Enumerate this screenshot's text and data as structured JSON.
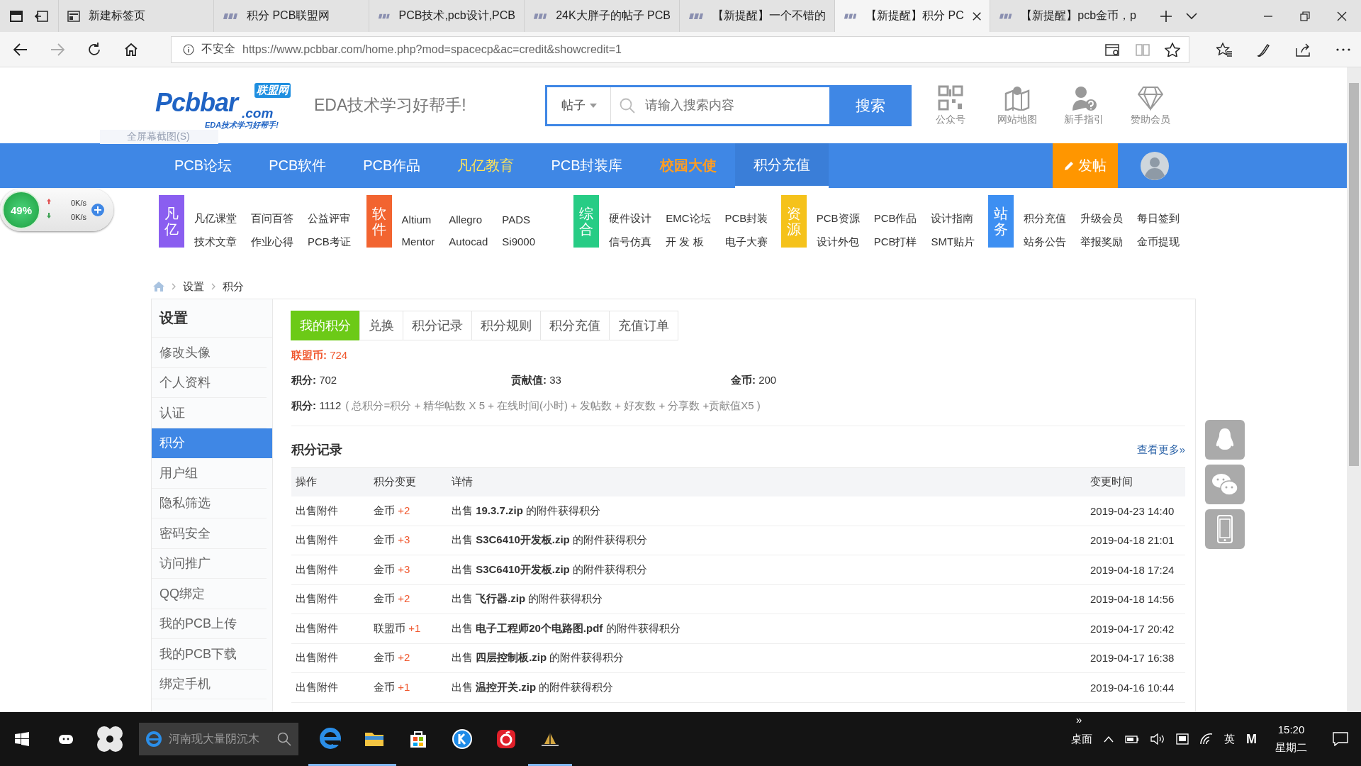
{
  "browser": {
    "tabs": [
      {
        "title": "新建标签页",
        "kind": "newtab",
        "selected": false
      },
      {
        "title": "积分 PCB联盟网",
        "kind": "site",
        "selected": false
      },
      {
        "title": "PCB技术,pcb设计,PCB",
        "kind": "site",
        "selected": false
      },
      {
        "title": "24K大胖子的帖子 PCB",
        "kind": "site",
        "selected": false
      },
      {
        "title": "【新提醒】一个不错的",
        "kind": "site",
        "selected": false
      },
      {
        "title": "【新提醒】积分 PC",
        "kind": "site",
        "selected": true
      },
      {
        "title": "【新提醒】pcb金币，p",
        "kind": "site",
        "selected": false
      }
    ],
    "nav_buttons": [
      {
        "kind": "back",
        "disabled": false
      },
      {
        "kind": "forward",
        "disabled": true
      },
      {
        "kind": "refresh",
        "disabled": false
      },
      {
        "kind": "home",
        "disabled": false
      }
    ],
    "security": "不安全",
    "url": "https://www.pcbbar.com/home.php?mod=spacecp&ac=credit&showcredit=1"
  },
  "header": {
    "logo": {
      "name": "Pcbbar",
      "suffix": ".com",
      "badge": "联盟网",
      "slogan": "EDA技术学习好帮手!"
    },
    "ghost_tooltip": "全屏幕截图(S)",
    "tagline": "EDA技术学习好帮手!",
    "search": {
      "scope": "帖子",
      "placeholder": "请输入搜索内容",
      "button": "搜索"
    },
    "links": [
      {
        "kind": "qrcode",
        "label": "公众号"
      },
      {
        "kind": "map",
        "label": "网站地图"
      },
      {
        "kind": "guide",
        "label": "新手指引"
      },
      {
        "kind": "diamond",
        "label": "赞助会员"
      }
    ]
  },
  "nav": {
    "items": [
      {
        "label": "PCB论坛",
        "kind": "normal",
        "selected": false
      },
      {
        "label": "PCB软件",
        "kind": "normal",
        "selected": false
      },
      {
        "label": "PCB作品",
        "kind": "normal",
        "selected": false
      },
      {
        "label": "凡亿教育",
        "kind": "highlight",
        "selected": false
      },
      {
        "label": "PCB封装库",
        "kind": "normal",
        "selected": false
      },
      {
        "label": "校园大使",
        "kind": "accent",
        "selected": false
      },
      {
        "label": "积分充值",
        "kind": "normal",
        "selected": true
      }
    ],
    "post_button": "发帖"
  },
  "subnav": [
    {
      "label": "凡亿",
      "color": "#8a5ef0",
      "links": [
        "凡亿课堂",
        "百问百答",
        "公益评审",
        "技术文章",
        "作业心得",
        "PCB考证"
      ]
    },
    {
      "label": "软件",
      "color": "#f26430",
      "links": [
        "Altium",
        "Allegro",
        "PADS",
        "Mentor",
        "Autocad",
        "Si9000"
      ]
    },
    {
      "label": "综合",
      "color": "#27cc85",
      "links": [
        "硬件设计",
        "EMC论坛",
        "PCB封装",
        "信号仿真",
        "开 发 板",
        "电子大赛"
      ]
    },
    {
      "label": "资源",
      "color": "#f5c21b",
      "links": [
        "PCB资源",
        "PCB作品",
        "设计指南",
        "设计外包",
        "PCB打样",
        "SMT贴片"
      ]
    },
    {
      "label": "站务",
      "color": "#3d8ff2",
      "links": [
        "积分充值",
        "升级会员",
        "每日签到",
        "站务公告",
        "举报奖励",
        "金币提现"
      ]
    }
  ],
  "speed_widget": {
    "percent": "49%",
    "up": "0K/s",
    "down": "0K/s"
  },
  "breadcrumb": [
    "设置",
    "积分"
  ],
  "sidebar": {
    "title": "设置",
    "items": [
      {
        "label": "修改头像",
        "selected": false
      },
      {
        "label": "个人资料",
        "selected": false
      },
      {
        "label": "认证",
        "selected": false
      },
      {
        "label": "积分",
        "selected": true
      },
      {
        "label": "用户组",
        "selected": false
      },
      {
        "label": "隐私筛选",
        "selected": false
      },
      {
        "label": "密码安全",
        "selected": false
      },
      {
        "label": "访问推广",
        "selected": false
      },
      {
        "label": "QQ绑定",
        "selected": false
      },
      {
        "label": "我的PCB上传",
        "selected": false
      },
      {
        "label": "我的PCB下载",
        "selected": false
      },
      {
        "label": "绑定手机",
        "selected": false
      }
    ]
  },
  "tabs": [
    {
      "label": "我的积分",
      "selected": true
    },
    {
      "label": "兑换",
      "selected": false
    },
    {
      "label": "积分记录",
      "selected": false
    },
    {
      "label": "积分规则",
      "selected": false
    },
    {
      "label": "积分充值",
      "selected": false
    },
    {
      "label": "充值订单",
      "selected": false
    }
  ],
  "balance": "**联盟币:** 724",
  "stats": [
    "**积分:** 702",
    "**贡献值:** 33",
    "**金币:** 200"
  ],
  "total": {
    "value": "**积分:** 1112",
    "formula": "( 总积分=积分 + 精华帖数 X 5 + 在线时间(小时) + 发帖数 + 好友数 + 分享数 +贡献值X5 )"
  },
  "records": {
    "title": "积分记录",
    "more": "查看更多»",
    "columns": [
      "操作",
      "积分变更",
      "详情",
      "变更时间"
    ],
    "rows": [
      {
        "action": "出售附件",
        "currency": "金币",
        "amount": "+2",
        "detail": "出售 **19.3.7.zip** 的附件获得积分",
        "time": "2019-04-23 14:40"
      },
      {
        "action": "出售附件",
        "currency": "金币",
        "amount": "+3",
        "detail": "出售 **S3C6410开发板.zip** 的附件获得积分",
        "time": "2019-04-18 21:01"
      },
      {
        "action": "出售附件",
        "currency": "金币",
        "amount": "+3",
        "detail": "出售 **S3C6410开发板.zip** 的附件获得积分",
        "time": "2019-04-18 17:24"
      },
      {
        "action": "出售附件",
        "currency": "金币",
        "amount": "+2",
        "detail": "出售 **飞行器.zip** 的附件获得积分",
        "time": "2019-04-18 14:56"
      },
      {
        "action": "出售附件",
        "currency": "联盟币",
        "amount": "+1",
        "detail": "出售 **电子工程师20个电路图.pdf** 的附件获得积分",
        "time": "2019-04-17 20:42"
      },
      {
        "action": "出售附件",
        "currency": "金币",
        "amount": "+2",
        "detail": "出售 **四层控制板.zip** 的附件获得积分",
        "time": "2019-04-17 16:38"
      },
      {
        "action": "出售附件",
        "currency": "金币",
        "amount": "+1",
        "detail": "出售 **温控开关.zip** 的附件获得积分",
        "time": "2019-04-16 10:44"
      }
    ]
  },
  "taskbar": {
    "search_placeholder": "河南现大量阴沉木",
    "apps": [
      {
        "kind": "edge",
        "running": true
      },
      {
        "kind": "folder",
        "running": true
      },
      {
        "kind": "store",
        "running": false
      },
      {
        "kind": "k",
        "running": false
      },
      {
        "kind": "music",
        "running": false
      },
      {
        "kind": "tool",
        "running": true
      }
    ],
    "overflow": "»",
    "desktop": "桌面",
    "ime": "英",
    "ime_mode": "M",
    "time": "15:20",
    "day": "星期二"
  }
}
